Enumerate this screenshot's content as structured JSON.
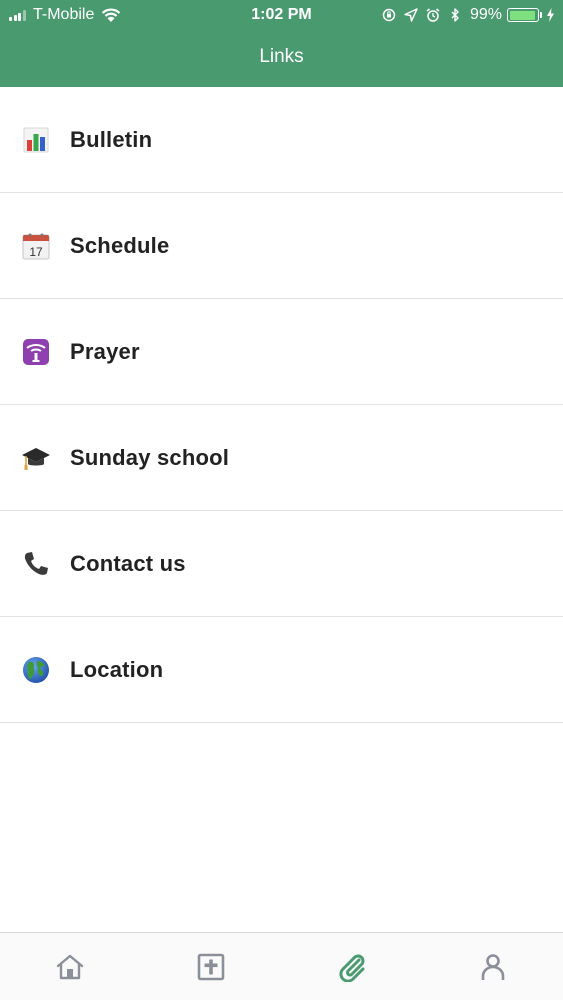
{
  "status_bar": {
    "carrier": "T-Mobile",
    "time": "1:02 PM",
    "battery_percent": "99%",
    "battery_level": 0.99
  },
  "header": {
    "title": "Links",
    "color": "#4a9a70"
  },
  "links": [
    {
      "label": "Bulletin",
      "icon": "bar-chart-icon"
    },
    {
      "label": "Schedule",
      "icon": "calendar-icon"
    },
    {
      "label": "Prayer",
      "icon": "prayer-icon"
    },
    {
      "label": "Sunday school",
      "icon": "graduation-cap-icon"
    },
    {
      "label": "Contact us",
      "icon": "phone-icon"
    },
    {
      "label": "Location",
      "icon": "globe-icon"
    }
  ],
  "calendar_day": "17",
  "tabbar": {
    "items": [
      {
        "icon": "home-icon",
        "active": false
      },
      {
        "icon": "bible-cross-icon",
        "active": false
      },
      {
        "icon": "paperclip-icon",
        "active": true
      },
      {
        "icon": "person-icon",
        "active": false
      }
    ],
    "active_color": "#4a9a70",
    "inactive_color": "#8a8f99"
  }
}
